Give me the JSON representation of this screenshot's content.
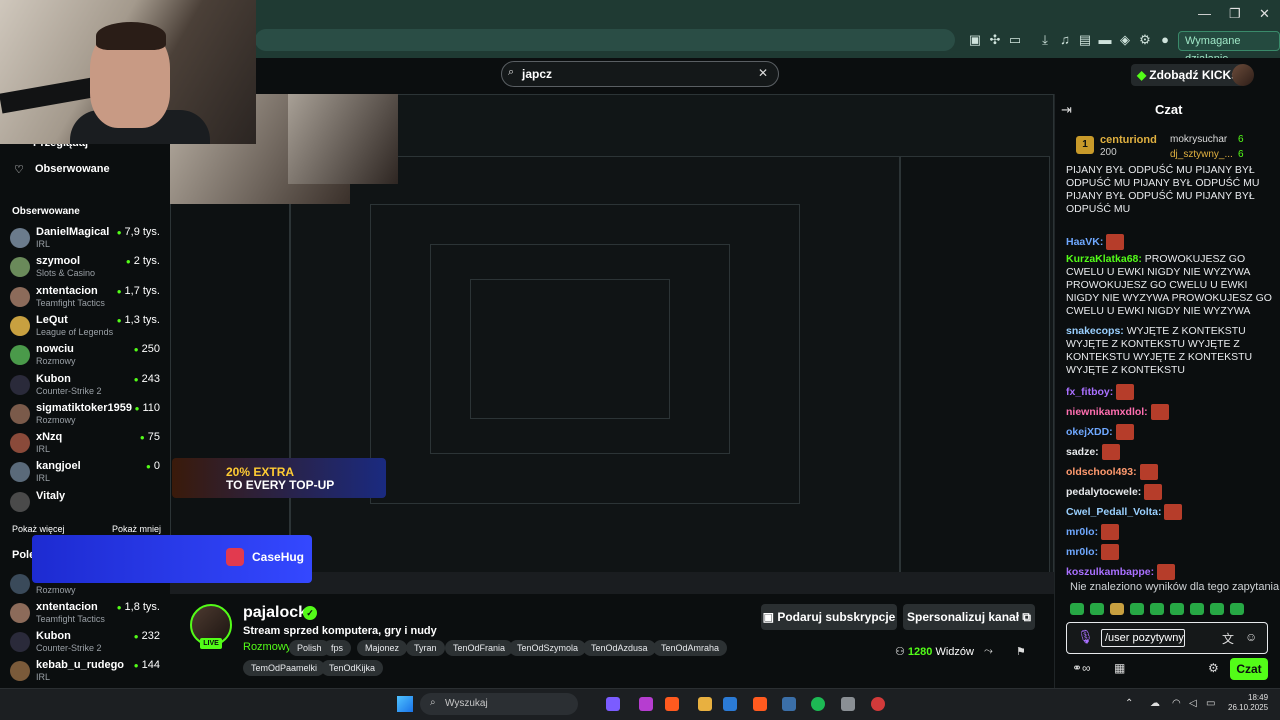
{
  "browser": {
    "required_action": "Wymagane działanie",
    "window_controls": [
      "—",
      "❐",
      "✕"
    ]
  },
  "search": {
    "query": "japcz",
    "clear": "✕"
  },
  "header": {
    "kicks_button": "Zdobądź KICKs",
    "kicks_icon": "◆"
  },
  "sidebar": {
    "top_label": "Przeglądaj",
    "following_nav": "Obserwowane",
    "section_title": "Obserwowane",
    "channels": [
      {
        "name": "DanielMagical",
        "category": "IRL",
        "viewers": "7,9 tys.",
        "color": "#6b7b8c"
      },
      {
        "name": "szymool",
        "category": "Slots & Casino",
        "viewers": "2 tys.",
        "color": "#6a8a5a"
      },
      {
        "name": "xntentacion",
        "category": "Teamfight Tactics",
        "viewers": "1,7 tys.",
        "color": "#8c6b5a"
      },
      {
        "name": "LeQut",
        "category": "League of Legends",
        "viewers": "1,3 tys.",
        "color": "#c8a040"
      },
      {
        "name": "nowciu",
        "category": "Rozmowy",
        "viewers": "250",
        "color": "#4a9a4a"
      },
      {
        "name": "Kubon",
        "category": "Counter-Strike 2",
        "viewers": "243",
        "color": "#2a2a3a"
      },
      {
        "name": "sigmatiktoker1959",
        "category": "Rozmowy",
        "viewers": "110",
        "color": "#7a5a4a"
      },
      {
        "name": "xNzq",
        "category": "IRL",
        "viewers": "75",
        "color": "#8a4a3a"
      },
      {
        "name": "kangjoel",
        "category": "IRL",
        "viewers": "0",
        "color": "#5a6a7a"
      },
      {
        "name": "Vitaly",
        "category": "",
        "viewers": "",
        "color": "#4a4a4a"
      }
    ],
    "show_more": "Pokaż więcej",
    "show_less": "Pokaż mniej",
    "recommended_title": "Polecane",
    "recommended": [
      {
        "name": "",
        "category": "Rozmowy",
        "viewers": "",
        "color": "#3a4a5a"
      },
      {
        "name": "xntentacion",
        "category": "Teamfight Tactics",
        "viewers": "1,8 tys.",
        "color": "#8c6b5a"
      },
      {
        "name": "Kubon",
        "category": "Counter-Strike 2",
        "viewers": "232",
        "color": "#2a2a3a"
      },
      {
        "name": "kebab_u_rudego",
        "category": "IRL",
        "viewers": "144",
        "color": "#7a5a3a"
      }
    ]
  },
  "overlay": {
    "casehug": "CaseHug",
    "promo_line1": "20% EXTRA",
    "promo_line2": "TO EVERY TOP-UP"
  },
  "chat": {
    "title": "Czat",
    "leaderboard": [
      {
        "rank": "1",
        "name": "centuriond",
        "points": "200"
      },
      {
        "name": "mokrysuchar",
        "points": "6"
      },
      {
        "name": "dj_sztywny_...",
        "points": "6"
      }
    ],
    "messages": [
      {
        "user": "",
        "color": "#e8eaed",
        "text": "PIJANY BYŁ ODPUŚĆ MU  PIJANY BYŁ ODPUŚĆ MU  PIJANY BYŁ ODPUŚĆ MU  PIJANY BYŁ ODPUŚĆ MU  PIJANY BYŁ ODPUŚĆ MU"
      },
      {
        "user": "HaaVK:",
        "color": "#6fa8ff",
        "text": ""
      },
      {
        "user": "KurzaKlatka68:",
        "color": "#53fc18",
        "text": "PROWOKUJESZ GO CWELU  U EWKI NIGDY NIE WYZYWA PROWOKUJESZ GO CWELU  U EWKI NIGDY NIE WYZYWA  PROWOKUJESZ GO CWELU  U EWKI NIGDY NIE WYZYWA"
      },
      {
        "user": "snakecops:",
        "color": "#9ad0ff",
        "text": "WYJĘTE Z KONTEKSTU  WYJĘTE Z KONTEKSTU  WYJĘTE Z KONTEKSTU  WYJĘTE Z KONTEKSTU  WYJĘTE Z KONTEKSTU"
      },
      {
        "user": "fx_fitboy:",
        "color": "#a970ff",
        "text": ""
      },
      {
        "user": "niewnikamxdlol:",
        "color": "#ff6fb0",
        "text": ""
      },
      {
        "user": "okejXDD:",
        "color": "#6fa8ff",
        "text": ""
      },
      {
        "user": "sadze:",
        "color": "#e8eaed",
        "text": ""
      },
      {
        "user": "oldschool493:",
        "color": "#ff9a6f",
        "text": ""
      },
      {
        "user": "pedalytocwele:",
        "color": "#e8eaed",
        "text": ""
      },
      {
        "user": "Cwel_Pedall_Volta:",
        "color": "#9ad0ff",
        "text": ""
      },
      {
        "user": "mr0lo:",
        "color": "#6fa8ff",
        "text": ""
      },
      {
        "user": "mr0lo:",
        "color": "#6fa8ff",
        "text": ""
      },
      {
        "user": "koszulkambappe:",
        "color": "#a970ff",
        "text": ""
      }
    ],
    "no_results": "Nie znaleziono wyników dla tego zapytania",
    "input_value": "/user pozytywny",
    "send": "Czat"
  },
  "channel": {
    "name": "pajalock",
    "live": "LIVE",
    "title": "Stream sprzed komputera, gry i nudy",
    "category": "Rozmowy",
    "tags": [
      "Polish",
      "fps",
      "Majonez",
      "Tyran",
      "TenOdFrania",
      "TenOdSzymola",
      "TenOdAzdusa",
      "TenOdAmraha",
      "TemOdPaamelki",
      "TenOdKijka"
    ],
    "subscribe": "Podaruj subskrypcje",
    "customize": "Spersonalizuj kanał",
    "viewers": "1280",
    "viewers_label": "Widzów"
  },
  "taskbar": {
    "search": "Wyszukaj",
    "time": "18:49",
    "date": "26.10.2025"
  }
}
